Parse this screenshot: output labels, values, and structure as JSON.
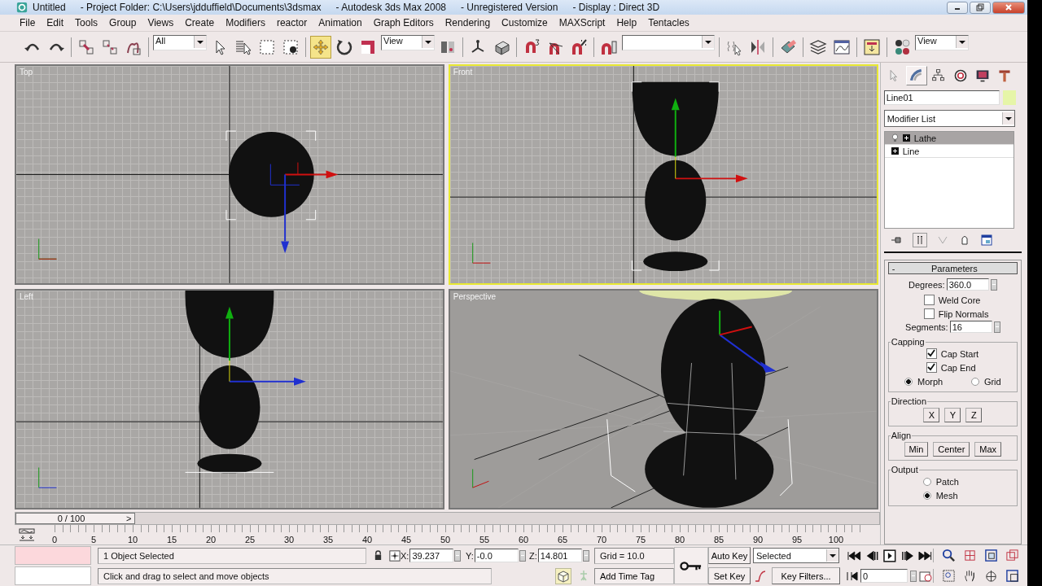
{
  "window": {
    "title_parts": [
      "Untitled",
      "- Project Folder: C:\\Users\\jdduffield\\Documents\\3dsmax",
      "- Autodesk 3ds Max 2008",
      "- Unregistered Version",
      "- Display : Direct 3D"
    ]
  },
  "menu": [
    "File",
    "Edit",
    "Tools",
    "Group",
    "Views",
    "Create",
    "Modifiers",
    "reactor",
    "Animation",
    "Graph Editors",
    "Rendering",
    "Customize",
    "MAXScript",
    "Help",
    "Tentacles"
  ],
  "toolbar": [
    {
      "kind": "tool",
      "selected": false
    },
    {
      "kind": "tool",
      "selected": false
    },
    {
      "kind": "separator"
    },
    {
      "kind": "tool",
      "selected": false
    },
    {
      "kind": "tool",
      "selected": false
    },
    {
      "kind": "tool",
      "selected": false
    },
    {
      "kind": "separator"
    },
    {
      "kind": "dropdown",
      "value": "All"
    },
    {
      "kind": "tool",
      "selected": false
    },
    {
      "kind": "tool",
      "selected": false
    },
    {
      "kind": "tool",
      "selected": false
    },
    {
      "kind": "tool",
      "selected": false
    },
    {
      "kind": "separator"
    },
    {
      "kind": "tool",
      "selected": true
    },
    {
      "kind": "tool",
      "selected": false
    },
    {
      "kind": "tool",
      "selected": false
    },
    {
      "kind": "dropdown",
      "value": "View"
    },
    {
      "kind": "tool",
      "selected": false
    },
    {
      "kind": "separator"
    },
    {
      "kind": "tool",
      "selected": false
    },
    {
      "kind": "tool",
      "selected": false
    },
    {
      "kind": "separator"
    },
    {
      "kind": "tool",
      "selected": false
    },
    {
      "kind": "tool",
      "selected": false
    },
    {
      "kind": "tool",
      "selected": false
    },
    {
      "kind": "separator"
    },
    {
      "kind": "tool",
      "selected": false
    },
    {
      "kind": "dropdown"
    },
    {
      "kind": "separator"
    },
    {
      "kind": "tool",
      "selected": false
    },
    {
      "kind": "tool",
      "selected": false
    },
    {
      "kind": "separator"
    },
    {
      "kind": "tool",
      "selected": false
    },
    {
      "kind": "separator"
    },
    {
      "kind": "tool",
      "selected": false
    },
    {
      "kind": "tool",
      "selected": false
    },
    {
      "kind": "separator"
    },
    {
      "kind": "tool",
      "selected": false
    },
    {
      "kind": "separator"
    },
    {
      "kind": "tool",
      "selected": false
    },
    {
      "kind": "dropdown",
      "value": "View"
    }
  ],
  "viewports": [
    {
      "label": "Top",
      "kind": "top",
      "active": false
    },
    {
      "label": "Front",
      "kind": "front",
      "active": true
    },
    {
      "label": "Left",
      "kind": "left",
      "active": false
    },
    {
      "label": "Perspective",
      "kind": "perspective",
      "active": false
    }
  ],
  "command_panel": {
    "tabs": [
      {
        "selected": false
      },
      {
        "selected": true
      },
      {
        "selected": false
      },
      {
        "selected": false
      },
      {
        "selected": false
      },
      {
        "selected": false
      }
    ],
    "object": {
      "name": "Line01",
      "color": "#e6f5a8"
    },
    "modifier_list": "Modifier List",
    "stack": [
      {
        "label": "Lathe",
        "selected": true,
        "bulb": true
      },
      {
        "label": "Line",
        "selected": false,
        "bulb": false
      }
    ]
  },
  "parameters": {
    "collapse": "-",
    "title": "Parameters",
    "degrees": {
      "label": "Degrees:",
      "value": "360.0"
    },
    "options": [
      {
        "label": "Weld Core",
        "checked": false
      },
      {
        "label": "Flip Normals",
        "checked": false
      }
    ],
    "segments": {
      "label": "Segments:",
      "value": "16"
    },
    "capping": {
      "title": "Capping",
      "options": [
        {
          "label": "Cap Start",
          "checked": true
        },
        {
          "label": "Cap End",
          "checked": true
        }
      ],
      "modes": [
        {
          "label": "Morph",
          "selected": true
        },
        {
          "label": "Grid",
          "selected": false
        }
      ]
    },
    "direction": {
      "title": "Direction",
      "buttons": [
        "X",
        "Y",
        "Z"
      ]
    },
    "align": {
      "title": "Align",
      "buttons": [
        "Min",
        "Center",
        "Max"
      ]
    },
    "output": {
      "title": "Output",
      "modes": [
        {
          "label": "Patch",
          "selected": false
        },
        {
          "label": "Mesh",
          "selected": true
        }
      ]
    }
  },
  "timeline": {
    "slider": "0 / 100",
    "next": ">",
    "level": 0,
    "ticks": [
      "0",
      "5",
      "10",
      "15",
      "20",
      "25",
      "30",
      "35",
      "40",
      "45",
      "50",
      "55",
      "60",
      "65",
      "70",
      "75",
      "80",
      "85",
      "90",
      "95",
      "100"
    ]
  },
  "status": {
    "selection": "1 Object Selected",
    "prompt": "Click and drag to select and move objects",
    "x": {
      "label": "X:",
      "value": "39.237"
    },
    "y": {
      "label": "Y:",
      "value": "-0.0"
    },
    "z": {
      "label": "Z:",
      "value": "14.801"
    },
    "grid": "Grid = 10.0",
    "time_tag": "Add Time Tag"
  },
  "animation": {
    "auto_key": "Auto Key",
    "set_key": "Set Key",
    "key_mode": "Selected",
    "key_filters": "Key Filters...",
    "frame": "0"
  }
}
